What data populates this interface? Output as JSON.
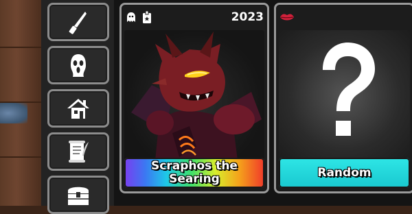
{
  "sidebar": {
    "items": [
      {
        "icon": "knife-icon"
      },
      {
        "icon": "ghostface-mask-icon"
      },
      {
        "icon": "house-icon"
      },
      {
        "icon": "scroll-quill-icon"
      },
      {
        "icon": "treasure-chest-icon"
      }
    ]
  },
  "cards": [
    {
      "year": "2023",
      "badges": [
        "ghost-icon",
        "id-badge-icon"
      ],
      "name": "Scraphos the Searing",
      "label_style": "rainbow"
    },
    {
      "badges": [
        "lips-icon"
      ],
      "name": "Random",
      "label_style": "cyan",
      "art": "question-mark-icon"
    }
  ],
  "colors": {
    "card_border": "#9a9a9a",
    "random_label": "#22d3dc",
    "lips": "#d0213b"
  }
}
